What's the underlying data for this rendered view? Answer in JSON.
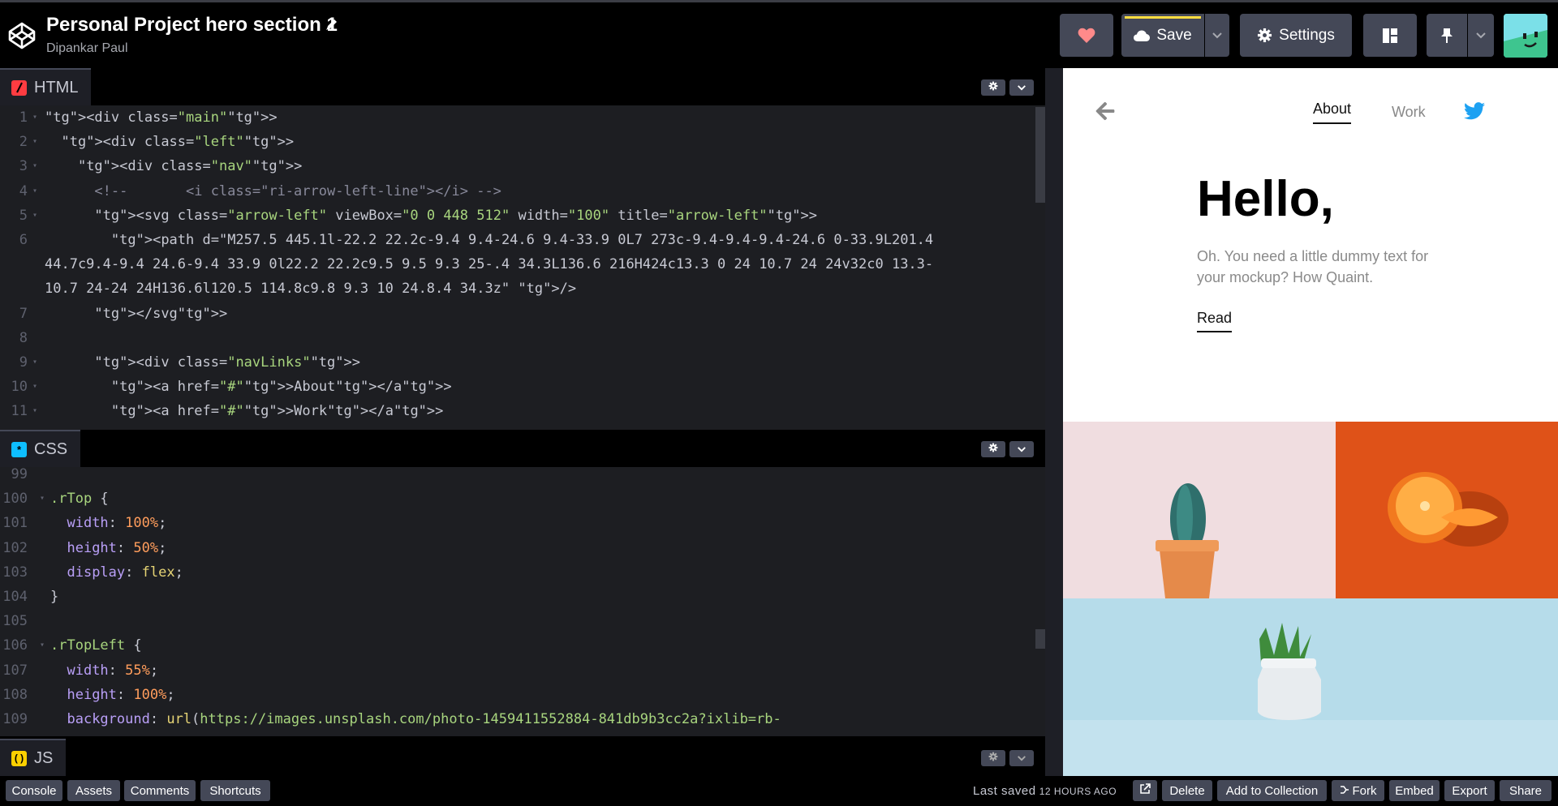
{
  "header": {
    "title": "Personal Project hero section 1",
    "author": "Dipankar Paul",
    "save_label": "Save",
    "settings_label": "Settings"
  },
  "html_panel": {
    "label": "HTML",
    "icon_color": "#ff3c41",
    "lines": [
      {
        "n": "1",
        "fold": true
      },
      {
        "n": "2",
        "fold": true
      },
      {
        "n": "3",
        "fold": true
      },
      {
        "n": "4",
        "fold": true
      },
      {
        "n": "5",
        "fold": true
      },
      {
        "n": "6",
        "fold": false
      },
      {
        "n": "",
        "fold": false
      },
      {
        "n": "",
        "fold": false
      },
      {
        "n": "7",
        "fold": false
      },
      {
        "n": "8",
        "fold": false
      },
      {
        "n": "9",
        "fold": true
      },
      {
        "n": "10",
        "fold": true
      },
      {
        "n": "11",
        "fold": true
      }
    ],
    "code": [
      "<div class=\"main\">",
      "  <div class=\"left\">",
      "    <div class=\"nav\">",
      "      <!--       <i class=\"ri-arrow-left-line\"></i> -->",
      "      <svg class=\"arrow-left\" viewBox=\"0 0 448 512\" width=\"100\" title=\"arrow-left\">",
      "        <path d=\"M257.5 445.1l-22.2 22.2c-9.4 9.4-24.6 9.4-33.9 0L7 273c-9.4-9.4-9.4-24.6 0-33.9L201.4",
      "44.7c9.4-9.4 24.6-9.4 33.9 0l22.2 22.2c9.5 9.5 9.3 25-.4 34.3L136.6 216H424c13.3 0 24 10.7 24 24v32c0 13.3-",
      "10.7 24-24 24H136.6l120.5 114.8c9.8 9.3 10 24.8.4 34.3z\" />",
      "      </svg>",
      "",
      "      <div class=\"navLinks\">",
      "        <a href=\"#\">About</a>",
      "        <a href=\"#\">Work</a>"
    ]
  },
  "css_panel": {
    "label": "CSS",
    "icon_color": "#0ebeff",
    "lines": [
      {
        "n": "99",
        "fold": false
      },
      {
        "n": "100",
        "fold": true
      },
      {
        "n": "101",
        "fold": false
      },
      {
        "n": "102",
        "fold": false
      },
      {
        "n": "103",
        "fold": false
      },
      {
        "n": "104",
        "fold": false
      },
      {
        "n": "105",
        "fold": false
      },
      {
        "n": "106",
        "fold": true
      },
      {
        "n": "107",
        "fold": false
      },
      {
        "n": "108",
        "fold": false
      },
      {
        "n": "109",
        "fold": false
      }
    ],
    "code": [
      "",
      ".rTop {",
      "  width: 100%;",
      "  height: 50%;",
      "  display: flex;",
      "}",
      "",
      ".rTopLeft {",
      "  width: 55%;",
      "  height: 100%;",
      "  background: url(https://images.unsplash.com/photo-1459411552884-841db9b3cc2a?ixlib=rb-"
    ]
  },
  "js_panel": {
    "label": "JS",
    "icon_color": "#fcd000"
  },
  "preview": {
    "nav_about": "About",
    "nav_work": "Work",
    "heading": "Hello,",
    "paragraph": "Oh. You need a little dummy text for your mockup? How Quaint.",
    "read_link": "Read"
  },
  "footer": {
    "console": "Console",
    "assets": "Assets",
    "comments": "Comments",
    "shortcuts": "Shortcuts",
    "last_saved_label": "Last saved",
    "last_saved_value": "12 HOURS AGO",
    "delete": "Delete",
    "add_to_collection": "Add to Collection",
    "fork": "Fork",
    "embed": "Embed",
    "export": "Export",
    "share": "Share"
  },
  "colors": {
    "accent_yellow": "#ffdd40",
    "heart": "#ff8a8a",
    "twitter": "#1da1f2",
    "button_bg": "#444857"
  }
}
